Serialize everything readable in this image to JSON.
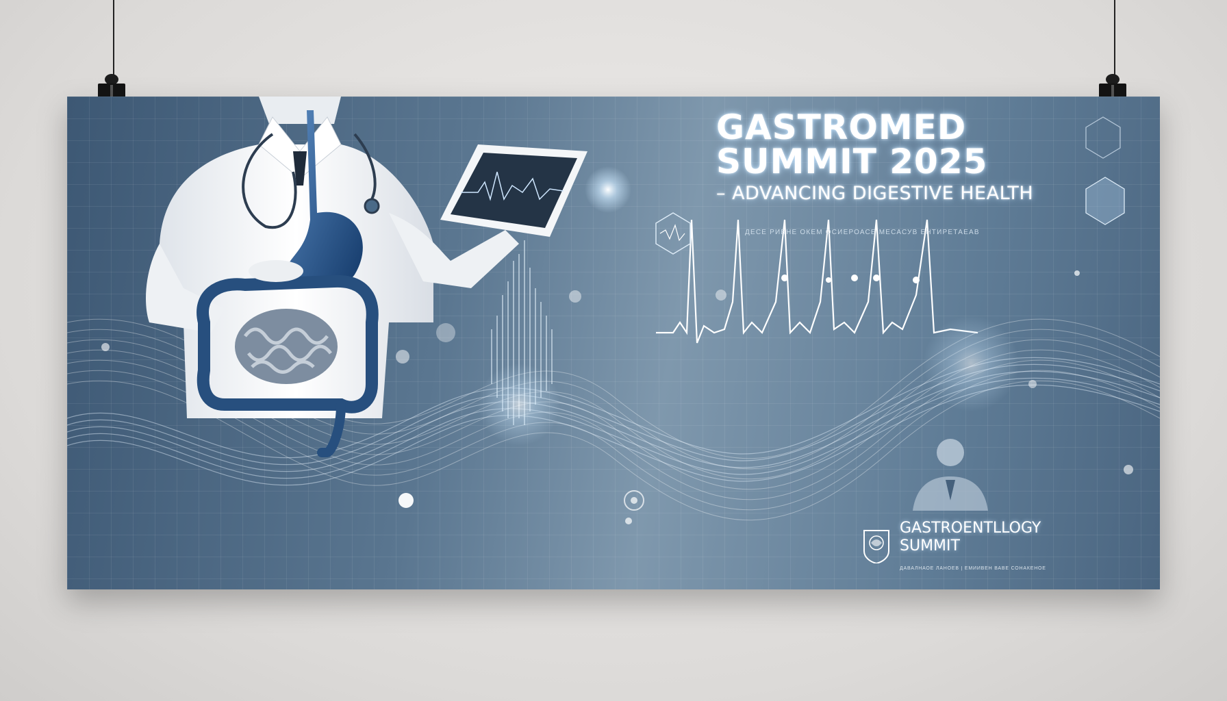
{
  "poster": {
    "title_line1": "GASTROMED",
    "title_line2": "SUMMIT 2025",
    "subtitle": "– ADVANCING DIGESTIVE HEALTH",
    "tagline": "ДЕСЕ РИБНЕ ОКЕМ ОСИЕРОАСЕ МЕСАСУВ ЕНТИРЕТАЕАВ",
    "logo_line1": "GASTROENTLLOGY",
    "logo_line2": "SUMMIT",
    "logo_small": "ДАВАЛНАОЕ ЛАНОЕВ | ЕМИИВЕН ВАВЕ СОНАКЕНОЕ"
  },
  "colors": {
    "wall": "#dcdad8",
    "poster_dark": "#3d5874",
    "poster_mid": "#7f98ad",
    "accent_glow": "#bfe3ff",
    "organ_blue": "#1f4f8a",
    "coat_white": "#f2f4f6"
  },
  "icons": [
    "binder-clip-icon",
    "stethoscope-icon",
    "tablet-icon",
    "doctor-avatar-icon",
    "emblem-icon",
    "ecg-wave-icon"
  ]
}
